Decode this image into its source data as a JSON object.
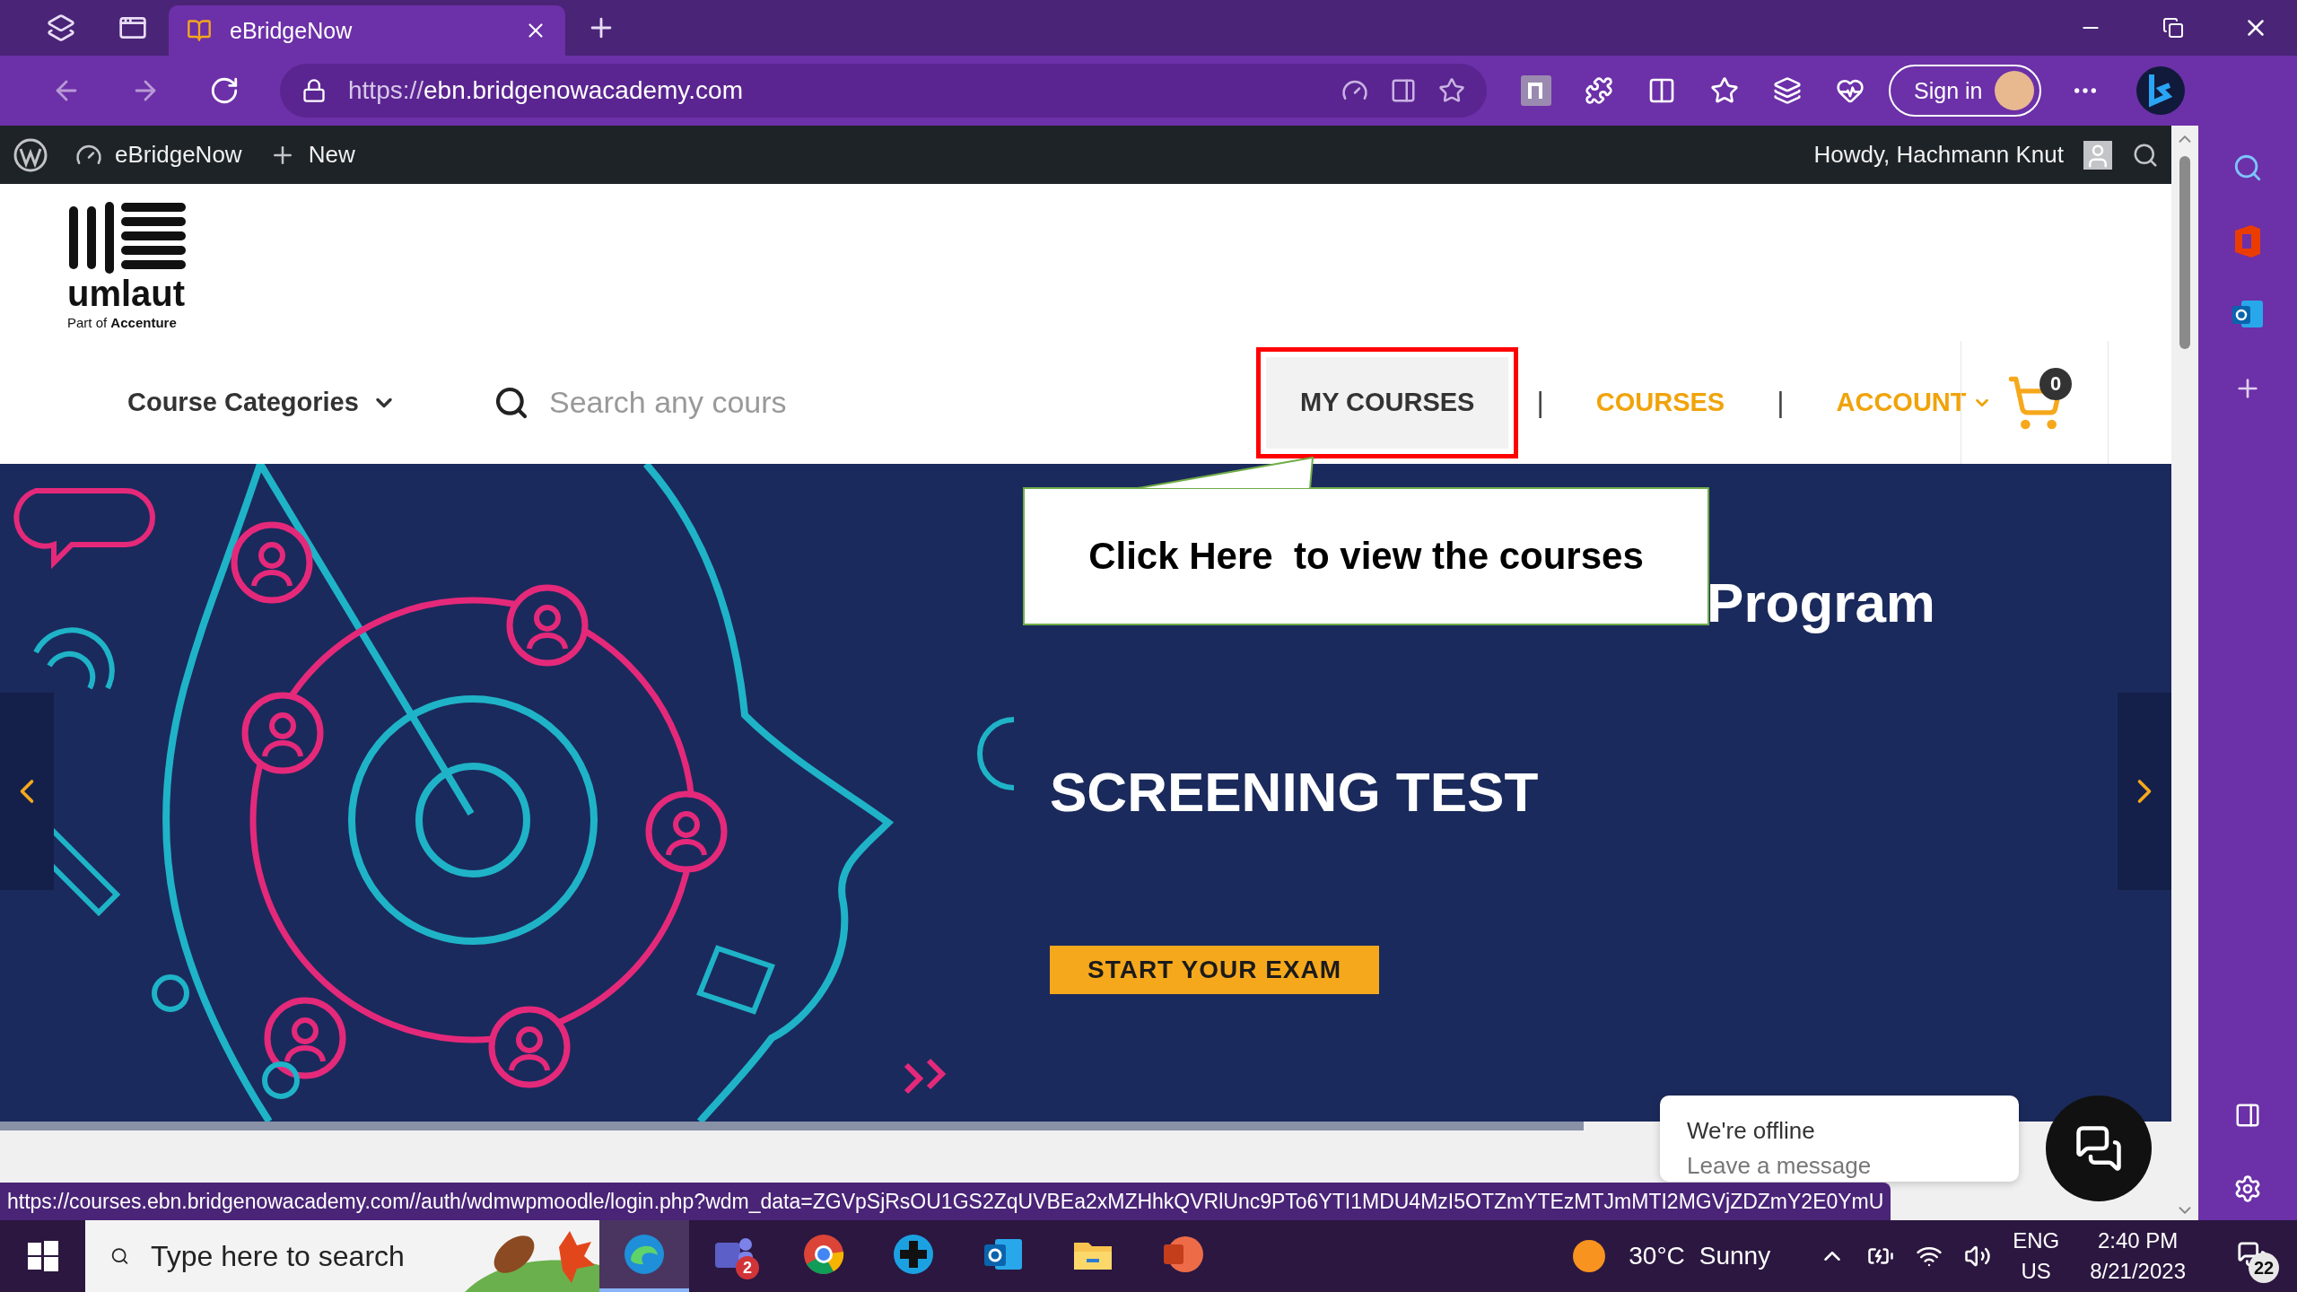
{
  "browser": {
    "tabs": [
      {
        "title": "eBridgeNow",
        "selected": true
      }
    ],
    "address": {
      "scheme": "https://",
      "host": "ebn.bridgenowacademy.com"
    },
    "sign_in": "Sign in"
  },
  "admin_bar": {
    "site": "eBridgeNow",
    "new": "New",
    "greeting": "Howdy, Hachmann Knut"
  },
  "header": {
    "logo": {
      "wordmark": "umlaut",
      "tagline": "Part of **Accenture**"
    },
    "categories": "Course Categories",
    "search": {
      "placeholder": "Search any cours"
    },
    "nav_separator": "|",
    "nav": [
      {
        "kind": "link",
        "label": "MY COURSES",
        "selected": true,
        "annotated": true
      },
      {
        "kind": "link",
        "label": "COURSES",
        "selected": false,
        "annotated": false
      },
      {
        "kind": "menu",
        "label": "ACCOUNT",
        "selected": false,
        "annotated": false
      }
    ],
    "cart_count": "0"
  },
  "callout": {
    "text": "Click Here  to view the courses"
  },
  "banner": {
    "title": "Program",
    "heading": "SCREENING TEST",
    "button": "START YOUR EXAM"
  },
  "chat": {
    "status": "We're offline",
    "prompt": "Leave a message"
  },
  "status_url": "https://courses.ebn.bridgenowacademy.com//auth/wdmwpmoodle/login.php?wdm_data=ZGVpSjRsOU1GS2ZqUVBEa2xMZHhkQVRlUnc9PTo6YTI1MDU4MzI5OTZmYTEzMTJmMTI2MGVjZDZmY2E0YmU",
  "taskbar": {
    "search_placeholder": "Type here to search",
    "apps": [
      {
        "kind": "edge",
        "selected": true
      },
      {
        "kind": "teams",
        "selected": false,
        "badge": "2"
      },
      {
        "kind": "chrome",
        "selected": false
      },
      {
        "kind": "plus",
        "selected": false
      },
      {
        "kind": "outlook",
        "selected": false
      },
      {
        "kind": "explorer",
        "selected": false
      },
      {
        "kind": "powerpoint",
        "selected": false
      }
    ],
    "weather": {
      "temperature": "30°C",
      "condition": "Sunny"
    },
    "language": "ENG",
    "region": "US",
    "time": "2:40 PM",
    "date": "8/21/2023",
    "notifications": "22"
  }
}
